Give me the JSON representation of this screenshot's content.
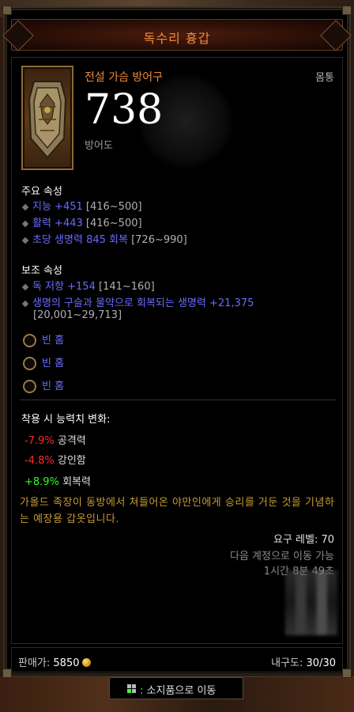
{
  "item": {
    "name": "독수리 흉갑",
    "type_line": "전설 가슴 방어구",
    "slot": "몸통",
    "armor_value": "738",
    "armor_label": "방어도"
  },
  "primary": {
    "title": "주요 속성",
    "stats": [
      {
        "text": "지능 +451",
        "range": "[416~500]"
      },
      {
        "text": "활력 +443",
        "range": "[416~500]"
      },
      {
        "text": "초당 생명력 845 회복",
        "range": "[726~990]"
      }
    ]
  },
  "secondary": {
    "title": "보조 속성",
    "stats": [
      {
        "text": "독 저항 +154",
        "range": "[141~160]"
      },
      {
        "text": "생명의 구슬과 물약으로 회복되는 생명력 +21,375",
        "range": "[20,001~29,713]"
      }
    ]
  },
  "sockets": [
    "빈 홈",
    "빈 홈",
    "빈 홈"
  ],
  "changes": {
    "title": "착용 시 능력치 변화:",
    "items": [
      {
        "value": "-7.9%",
        "label": "공격력",
        "color": "#ff2a2a"
      },
      {
        "value": "-4.8%",
        "label": "강인함",
        "color": "#ff2a2a"
      },
      {
        "value": "+8.9%",
        "label": "회복력",
        "color": "#2aff2a"
      }
    ]
  },
  "flavor": "가올드 족장이 동방에서 쳐들어온 야만인에게 승리를 거둔 것을 기념하는 예장용 갑옷입니다.",
  "requirements": {
    "level": "요구 레벨: 70",
    "account_bound": "다음 계정으로 이동 가능",
    "time_left": "1시간 8분 49초"
  },
  "footer": {
    "price_label": "판매가:",
    "price_value": "5850",
    "durability_label": "내구도:",
    "durability_value": "30/30"
  },
  "action": {
    "key": ":",
    "label": "소지품으로 이동"
  },
  "colors": {
    "legendary": "#f08a3a",
    "magic": "#6a6aff",
    "negative": "#ff2a2a",
    "positive": "#2aff2a",
    "flavor": "#c89a30"
  }
}
